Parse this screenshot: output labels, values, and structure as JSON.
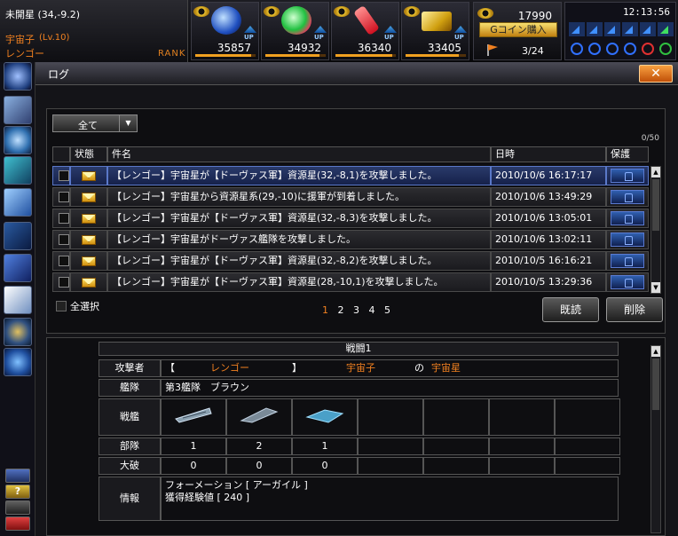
{
  "player": {
    "location": "未開星 (34,-9.2)",
    "coords": "(34,-9.2)",
    "name": "宇宙子",
    "level": "(Lv.10)",
    "faction": "レンゴー",
    "rank_label": "RANK"
  },
  "resources": [
    {
      "name": "crystal-resource",
      "value": "35857",
      "up": "UP",
      "color": "#4070e0"
    },
    {
      "name": "energy-resource",
      "value": "34932",
      "up": "UP",
      "color": "#30c050"
    },
    {
      "name": "fuel-resource",
      "value": "36340",
      "up": "UP",
      "color": "#e04040"
    },
    {
      "name": "gold-resource",
      "value": "33405",
      "up": "UP",
      "color": "#e0b020"
    }
  ],
  "coins": {
    "value": "17990",
    "buy_label": "Gコイン購入",
    "fleet_count": "3/24"
  },
  "clock": "12:13:56",
  "window": {
    "title": "ログ",
    "close_label": "✕"
  },
  "filter": {
    "selected": "全て"
  },
  "message_count": "0/50",
  "columns": {
    "status": "状態",
    "subject": "件名",
    "date": "日時",
    "protect": "保護"
  },
  "messages": [
    {
      "subject": "【レンゴー】宇宙星が【ドーヴァス軍】資源星(32,-8,1)を攻撃しました。",
      "date": "2010/10/6 16:17:17",
      "selected": true
    },
    {
      "subject": "【レンゴー】宇宙星から資源星系(29,-10)に援軍が到着しました。",
      "date": "2010/10/6 13:49:29"
    },
    {
      "subject": "【レンゴー】宇宙星が【ドーヴァス軍】資源星(32,-8,3)を攻撃しました。",
      "date": "2010/10/6 13:05:01"
    },
    {
      "subject": "【レンゴー】宇宙星がドーヴァス艦隊を攻撃しました。",
      "date": "2010/10/6 13:02:11"
    },
    {
      "subject": "【レンゴー】宇宙星が【ドーヴァス軍】資源星(32,-8,2)を攻撃しました。",
      "date": "2010/10/5 16:16:21"
    },
    {
      "subject": "【レンゴー】宇宙星が【ドーヴァス軍】資源星(28,-10,1)を攻撃しました。",
      "date": "2010/10/5 13:29:36"
    }
  ],
  "select_all_label": "全選択",
  "pages": [
    "1",
    "2",
    "3",
    "4",
    "5"
  ],
  "buttons": {
    "read": "既読",
    "delete": "削除"
  },
  "battle": {
    "header": "戦闘1",
    "attacker_label": "攻撃者",
    "attacker_open": "【",
    "attacker_faction": "レンゴー",
    "attacker_close": "】",
    "attacker_name": "宇宙子",
    "attacker_of": "の",
    "attacker_planet": "宇宙星",
    "fleet_label": "艦隊",
    "fleet_value": "第3艦隊　ブラウン",
    "ships_label": "戦艦",
    "units_label": "部隊",
    "units": [
      "1",
      "2",
      "1"
    ],
    "destroyed_label": "大破",
    "destroyed": [
      "0",
      "0",
      "0"
    ],
    "info_label": "情報",
    "info_line1": "フォーメーション [ アーガイル ]",
    "info_line2": "獲得経験値 [ 240 ]"
  }
}
